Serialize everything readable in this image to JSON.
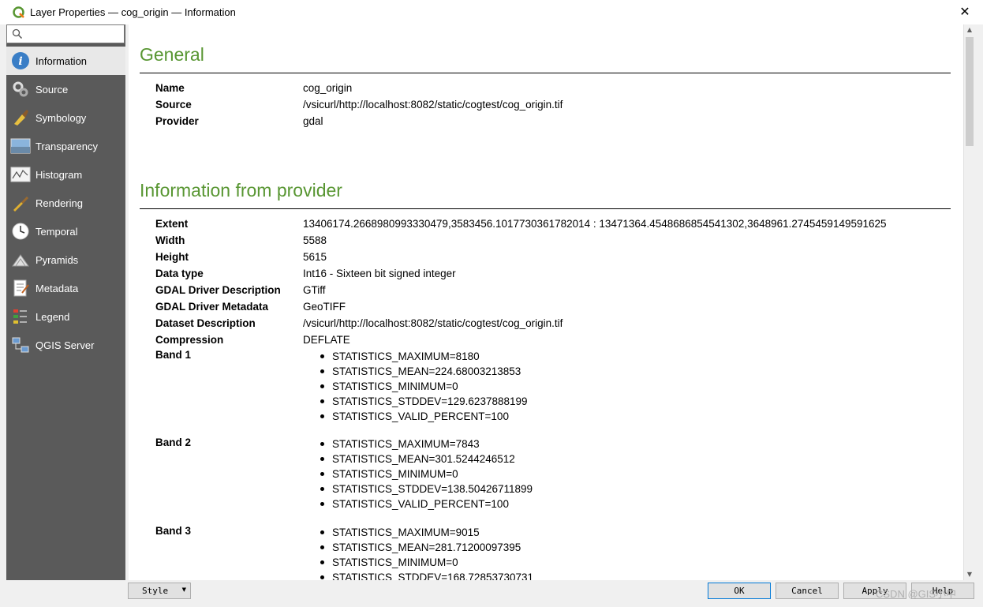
{
  "window": {
    "title": "Layer Properties — cog_origin — Information",
    "close_glyph": "✕"
  },
  "search": {
    "placeholder": ""
  },
  "sidebar": {
    "items": [
      {
        "label": "Information",
        "icon": "info-icon",
        "active": true
      },
      {
        "label": "Source",
        "icon": "source-icon"
      },
      {
        "label": "Symbology",
        "icon": "symbology-icon"
      },
      {
        "label": "Transparency",
        "icon": "transparency-icon"
      },
      {
        "label": "Histogram",
        "icon": "histogram-icon"
      },
      {
        "label": "Rendering",
        "icon": "rendering-icon"
      },
      {
        "label": "Temporal",
        "icon": "clock-icon"
      },
      {
        "label": "Pyramids",
        "icon": "pyramids-icon"
      },
      {
        "label": "Metadata",
        "icon": "metadata-icon"
      },
      {
        "label": "Legend",
        "icon": "legend-icon"
      },
      {
        "label": "QGIS Server",
        "icon": "server-icon"
      }
    ]
  },
  "general": {
    "heading": "General",
    "rows": [
      {
        "key": "Name",
        "value": "cog_origin"
      },
      {
        "key": "Source",
        "value": "/vsicurl/http://localhost:8082/static/cogtest/cog_origin.tif"
      },
      {
        "key": "Provider",
        "value": "gdal"
      }
    ]
  },
  "provider": {
    "heading": "Information from provider",
    "rows": [
      {
        "key": "Extent",
        "value": "13406174.2668980993330479,3583456.1017730361782014 : 13471364.4548686854541302,3648961.2745459149591625"
      },
      {
        "key": "Width",
        "value": "5588"
      },
      {
        "key": "Height",
        "value": "5615"
      },
      {
        "key": "Data type",
        "value": "Int16 - Sixteen bit signed integer"
      },
      {
        "key": "GDAL Driver Description",
        "value": "GTiff"
      },
      {
        "key": "GDAL Driver Metadata",
        "value": "GeoTIFF"
      },
      {
        "key": "Dataset Description",
        "value": "/vsicurl/http://localhost:8082/static/cogtest/cog_origin.tif"
      },
      {
        "key": "Compression",
        "value": "DEFLATE"
      }
    ],
    "bands": [
      {
        "label": "Band 1",
        "stats": [
          "STATISTICS_MAXIMUM=8180",
          "STATISTICS_MEAN=224.68003213853",
          "STATISTICS_MINIMUM=0",
          "STATISTICS_STDDEV=129.6237888199",
          "STATISTICS_VALID_PERCENT=100"
        ]
      },
      {
        "label": "Band 2",
        "stats": [
          "STATISTICS_MAXIMUM=7843",
          "STATISTICS_MEAN=301.5244246512",
          "STATISTICS_MINIMUM=0",
          "STATISTICS_STDDEV=138.50426711899",
          "STATISTICS_VALID_PERCENT=100"
        ]
      },
      {
        "label": "Band 3",
        "stats": [
          "STATISTICS_MAXIMUM=9015",
          "STATISTICS_MEAN=281.71200097395",
          "STATISTICS_MINIMUM=0",
          "STATISTICS_STDDEV=168.72853730731"
        ]
      }
    ]
  },
  "buttons": {
    "style": "Style",
    "ok": "OK",
    "cancel": "Cancel",
    "apply": "Apply",
    "help": "Help"
  },
  "watermark": "CSDN @GIS小中",
  "colors": {
    "heading_green": "#589632",
    "sidebar_bg": "#5a5a5a",
    "active_item_bg": "#e8e8e8"
  }
}
